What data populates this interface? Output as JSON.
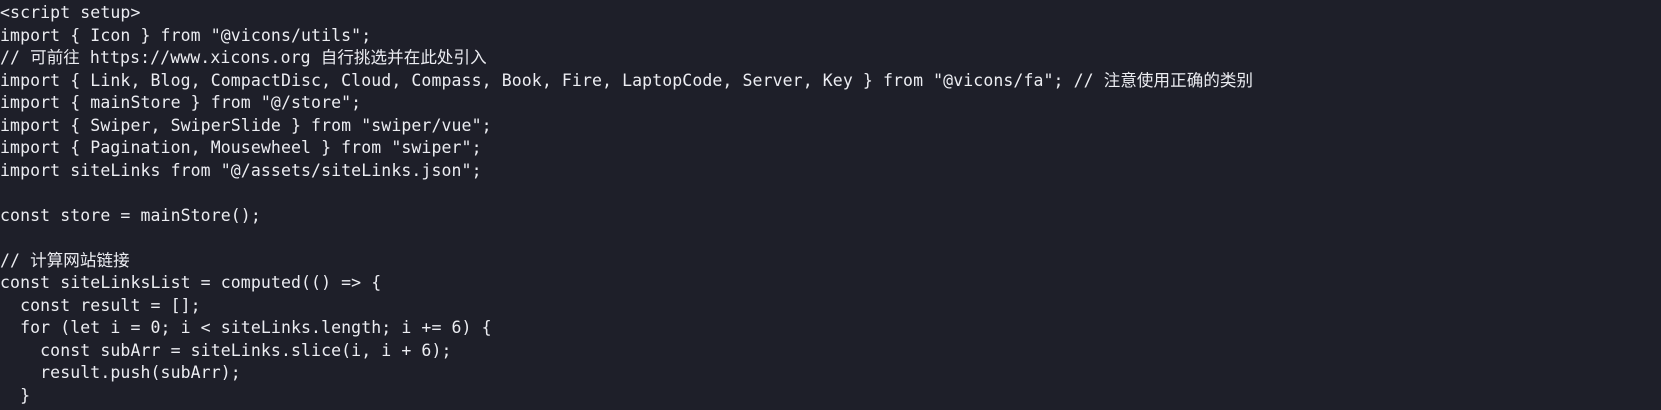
{
  "editor": {
    "lines": [
      "<script setup>",
      "import { Icon } from \"@vicons/utils\";",
      "// 可前往 https://www.xicons.org 自行挑选并在此处引入",
      "import { Link, Blog, CompactDisc, Cloud, Compass, Book, Fire, LaptopCode, Server, Key } from \"@vicons/fa\"; // 注意使用正确的类别",
      "import { mainStore } from \"@/store\";",
      "import { Swiper, SwiperSlide } from \"swiper/vue\";",
      "import { Pagination, Mousewheel } from \"swiper\";",
      "import siteLinks from \"@/assets/siteLinks.json\";",
      "",
      "const store = mainStore();",
      "",
      "// 计算网站链接",
      "const siteLinksList = computed(() => {",
      "  const result = [];",
      "  for (let i = 0; i < siteLinks.length; i += 6) {",
      "    const subArr = siteLinks.slice(i, i + 6);",
      "    result.push(subArr);",
      "  }"
    ]
  },
  "colors": {
    "background": "#1e1f29",
    "text": "#ecedf2"
  }
}
